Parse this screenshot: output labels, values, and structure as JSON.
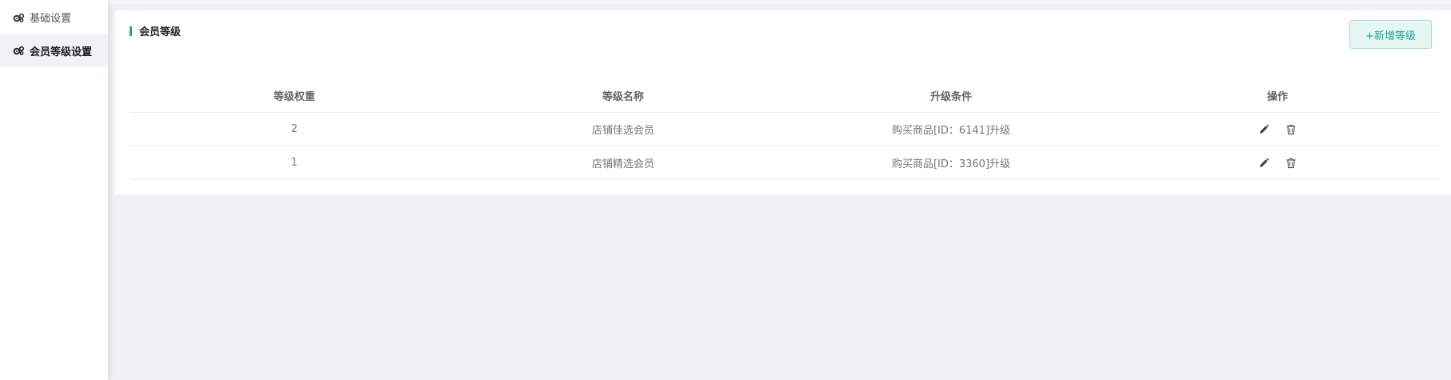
{
  "sidebar": {
    "items": [
      {
        "label": "基础设置",
        "icon": "gears-icon",
        "active": false
      },
      {
        "label": "会员等级设置",
        "icon": "gears-icon",
        "active": true
      }
    ]
  },
  "card": {
    "title": "会员等级",
    "add_button_label": "+新增等级"
  },
  "table": {
    "headers": [
      "等级权重",
      "等级名称",
      "升级条件",
      "操作"
    ],
    "rows": [
      {
        "weight": "2",
        "name": "店铺佳选会员",
        "condition": "购买商品[ID：6141]升级"
      },
      {
        "weight": "1",
        "name": "店铺精选会员",
        "condition": "购买商品[ID：3360]升级"
      }
    ]
  },
  "colors": {
    "accent": "#1aa58f",
    "background": "#eef2f5"
  }
}
